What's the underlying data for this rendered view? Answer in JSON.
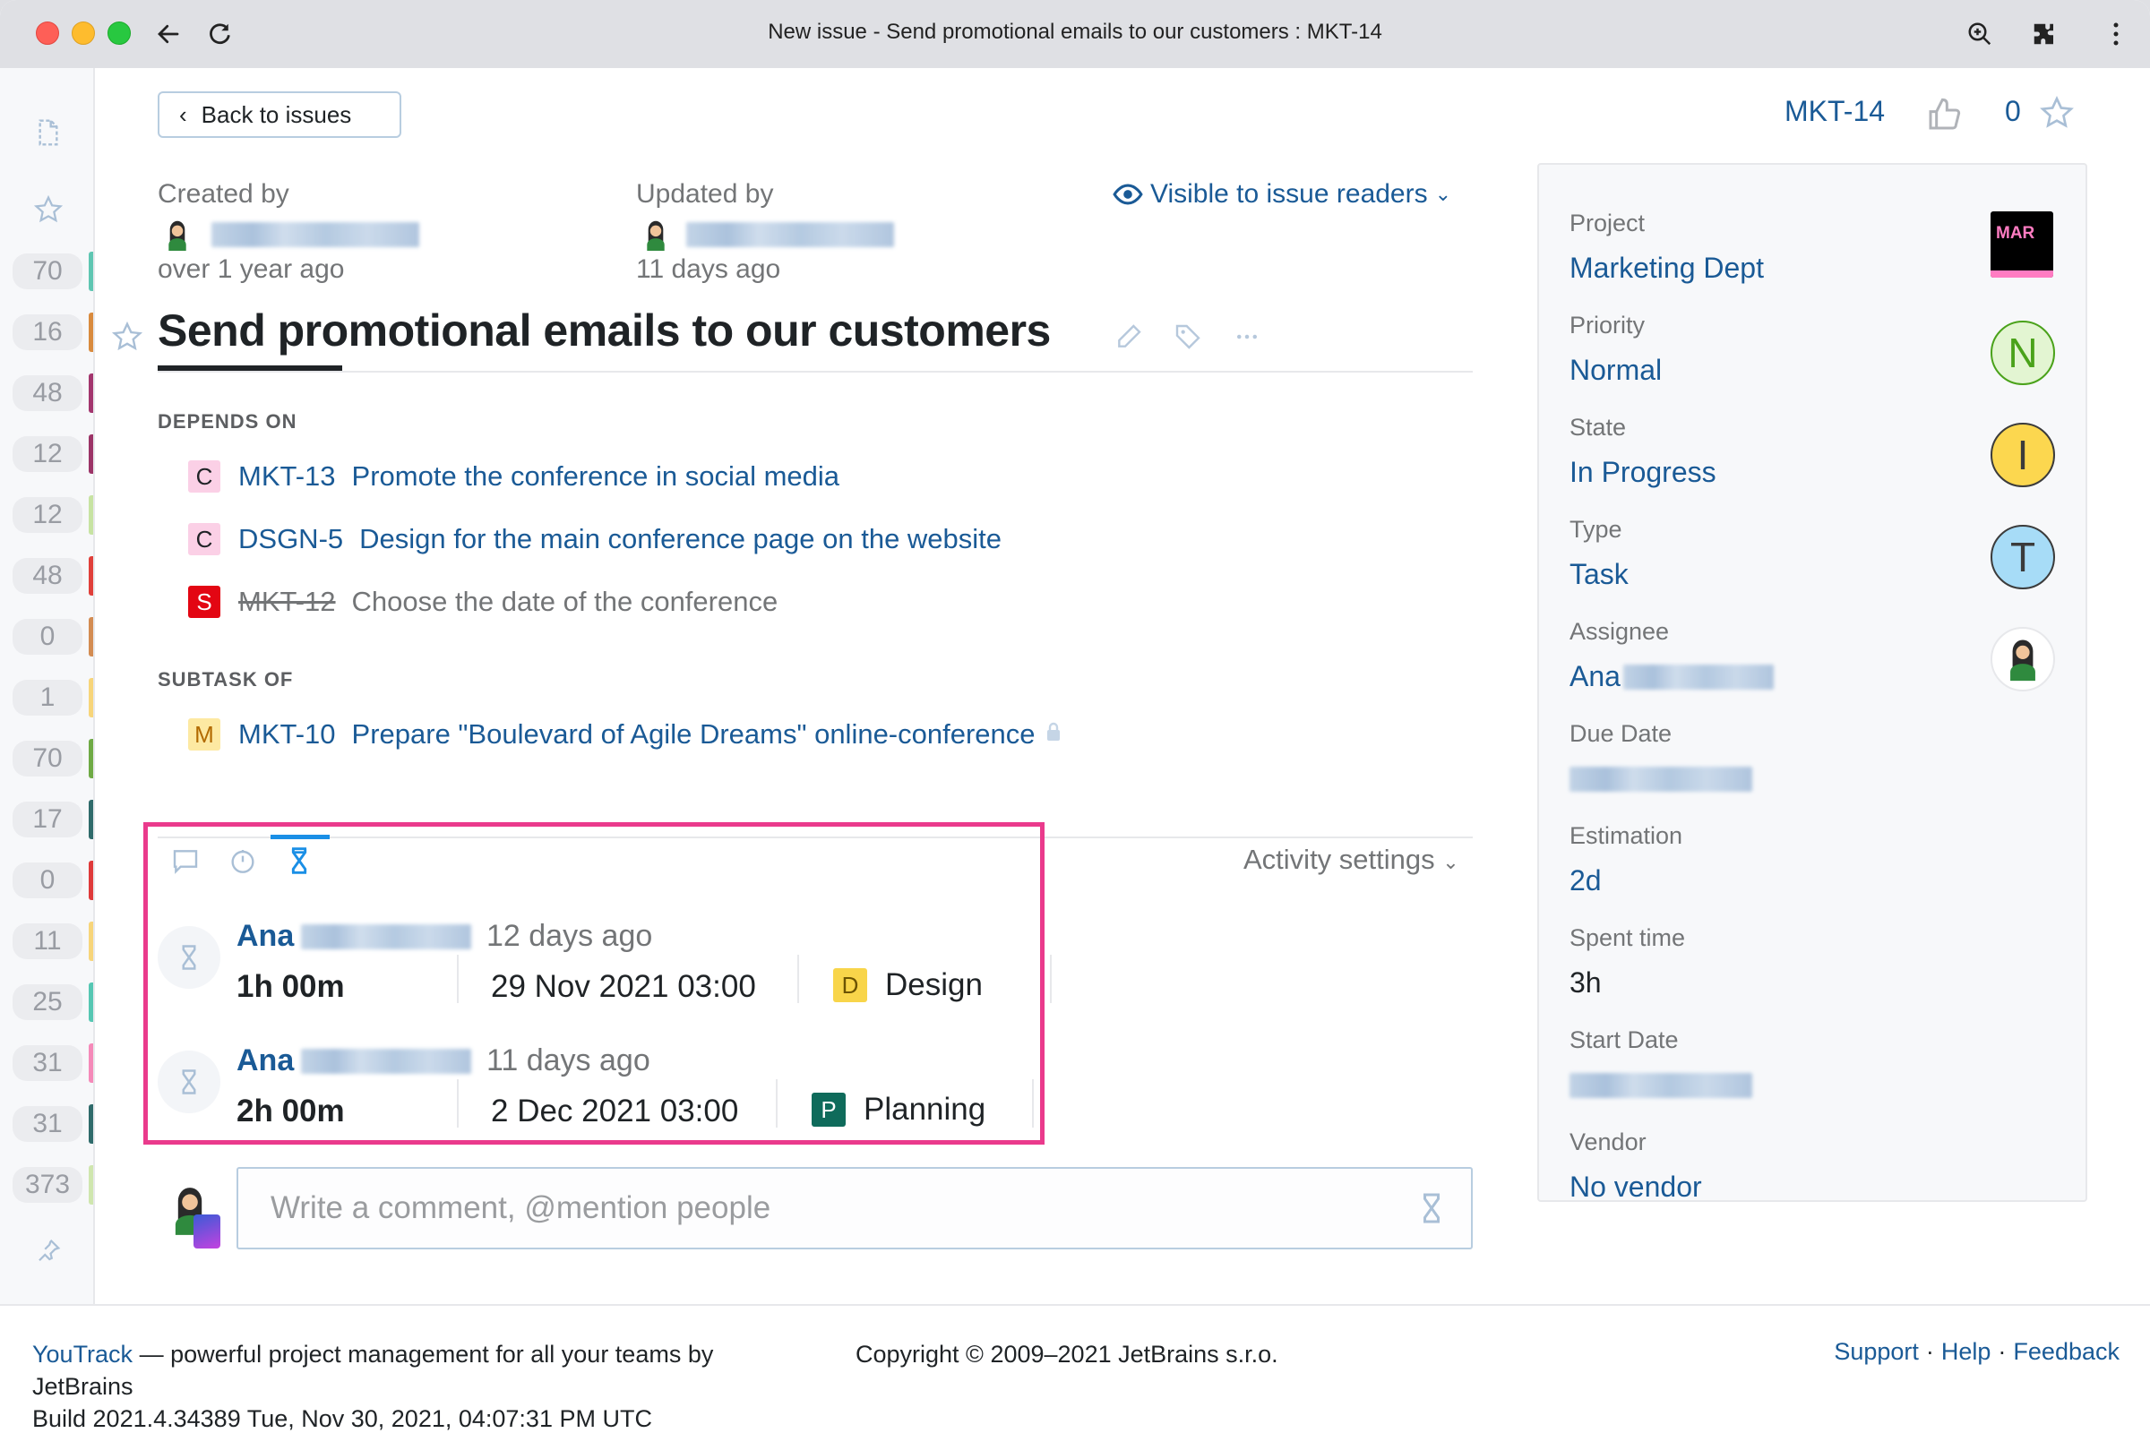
{
  "browser": {
    "title": "New issue - Send promotional emails to our customers : MKT-14",
    "back_icon": "arrow-left-icon",
    "reload_icon": "reload-icon",
    "zoom_icon": "zoom-icon",
    "extensions_icon": "puzzle-icon",
    "menu_icon": "kebab-menu-icon"
  },
  "sidebar": {
    "top_icons": [
      "document-icon",
      "star-icon"
    ],
    "counters": [
      {
        "count": "70",
        "color": "#5fc6b2"
      },
      {
        "count": "16",
        "color": "#d98b3e"
      },
      {
        "count": "48",
        "color": "#a3366e"
      },
      {
        "count": "12",
        "color": "#9c3467"
      },
      {
        "count": "12",
        "color": "#c7e3a2"
      },
      {
        "count": "48",
        "color": "#e0403a"
      },
      {
        "count": "0",
        "color": "#d38c52"
      },
      {
        "count": "1",
        "color": "#f7d57a"
      },
      {
        "count": "70",
        "color": "#6faa45"
      },
      {
        "count": "17",
        "color": "#2f6b6b"
      },
      {
        "count": "0",
        "color": "#df3a3a"
      },
      {
        "count": "11",
        "color": "#f7d57a"
      },
      {
        "count": "25",
        "color": "#56c7b3"
      },
      {
        "count": "31",
        "color": "#f58ab9"
      },
      {
        "count": "31",
        "color": "#2f6b6b"
      },
      {
        "count": "373",
        "color": "#cfe6ae"
      }
    ],
    "bottom_icon": "pin-icon"
  },
  "header": {
    "back_label": "Back to issues",
    "created_label": "Created by",
    "created_ago": "over 1 year ago",
    "updated_label": "Updated by",
    "updated_ago": "11 days ago",
    "visibility_label": "Visible to issue readers"
  },
  "issue": {
    "id": "MKT-14",
    "title": "Send promotional emails to our customers",
    "votes": "0"
  },
  "links": {
    "depends_on_label": "DEPENDS ON",
    "depends_on": [
      {
        "tag": "C",
        "tag_bg": "#fbd0e6",
        "tag_fg": "#1f2326",
        "id": "MKT-13",
        "summary": "Promote the conference in social media",
        "resolved": false
      },
      {
        "tag": "C",
        "tag_bg": "#fbd0e6",
        "tag_fg": "#1f2326",
        "id": "DSGN-5",
        "summary": "Design for the main conference page on the website",
        "resolved": false
      },
      {
        "tag": "S",
        "tag_bg": "#e30613",
        "tag_fg": "#ffffff",
        "id": "MKT-12",
        "summary": "Choose the date of the conference",
        "resolved": true
      }
    ],
    "subtask_of_label": "SUBTASK OF",
    "subtask_of": [
      {
        "tag": "M",
        "tag_bg": "#fde9a2",
        "tag_fg": "#b26a00",
        "id": "MKT-10",
        "summary": "Prepare \"Boulevard of Agile Dreams\" online-conference",
        "locked": true
      }
    ]
  },
  "activity": {
    "tabs": [
      {
        "icon": "comment-icon",
        "active": false
      },
      {
        "icon": "history-icon",
        "active": false
      },
      {
        "icon": "hourglass-icon",
        "active": true
      }
    ],
    "settings_label": "Activity settings",
    "work_items": [
      {
        "author": "Ana",
        "ago": "12 days ago",
        "duration": "1h 00m",
        "date": "29 Nov 2021 03:00",
        "type_tag": "D",
        "type_tag_bg": "#f8d54a",
        "type_tag_fg": "#6b5300",
        "type": "Design"
      },
      {
        "author": "Ana",
        "ago": "11 days ago",
        "duration": "2h 00m",
        "date": "2 Dec 2021 03:00",
        "type_tag": "P",
        "type_tag_bg": "#0f6b5b",
        "type_tag_fg": "#ffffff",
        "type": "Planning"
      }
    ],
    "highlight_color": "#ea3a8c"
  },
  "comment": {
    "placeholder": "Write a comment, @mention people"
  },
  "fields": [
    {
      "label": "Project",
      "value": "Marketing Dept",
      "badge": "MAR"
    },
    {
      "label": "Priority",
      "value": "Normal",
      "badge": "N",
      "badge_bg": "#e3f5d2",
      "badge_fg": "#4aa21a",
      "badge_border": "#4aa21a"
    },
    {
      "label": "State",
      "value": "In Progress",
      "badge": "I",
      "badge_bg": "#fcd74f",
      "badge_fg": "#3b3b3b",
      "badge_border": "#3b3b3b"
    },
    {
      "label": "Type",
      "value": "Task",
      "badge": "T",
      "badge_bg": "#a7dcf7",
      "badge_fg": "#3b3b3b",
      "badge_border": "#3b3b3b"
    },
    {
      "label": "Assignee",
      "value": "Ana"
    },
    {
      "label": "Due Date",
      "value": ""
    },
    {
      "label": "Estimation",
      "value": "2d"
    },
    {
      "label": "Spent time",
      "value": "3h"
    },
    {
      "label": "Start Date",
      "value": ""
    },
    {
      "label": "Vendor",
      "value": "No vendor"
    }
  ],
  "footer": {
    "brand_link": "YouTrack",
    "tagline": " — powerful project management for all your teams by",
    "tagline2": "JetBrains",
    "build": "Build 2021.4.34389 Tue, Nov 30, 2021, 04:07:31 PM UTC",
    "copyright": "Copyright © 2009–2021 JetBrains s.r.o.",
    "links": [
      "Support",
      "Help",
      "Feedback"
    ]
  },
  "colors": {
    "link": "#1a5a96",
    "accent": "#1a8fe6"
  }
}
